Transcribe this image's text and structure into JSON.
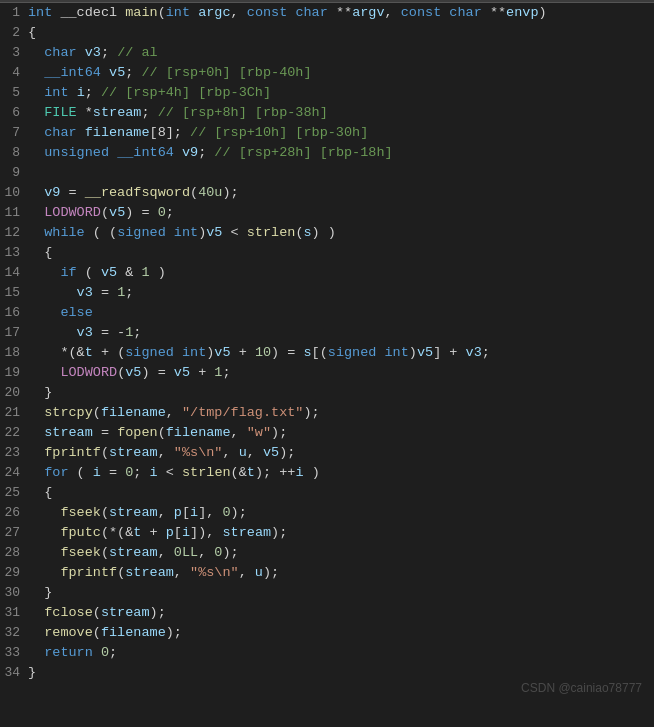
{
  "watermark": "CSDN @cainiao78777",
  "lines": [
    {
      "num": 1,
      "html": "<span class='kw'>int</span> <span class='plain'>__cdecl </span><span class='fn'>main</span><span class='plain'>(</span><span class='kw'>int</span> <span class='var'>argc</span><span class='plain'>, </span><span class='kw'>const</span> <span class='kw'>char</span> <span class='plain'>**</span><span class='var'>argv</span><span class='plain'>, </span><span class='kw'>const</span> <span class='kw'>char</span> <span class='plain'>**</span><span class='var'>envp</span><span class='plain'>)</span>"
    },
    {
      "num": 2,
      "html": "<span class='plain'>{</span>"
    },
    {
      "num": 3,
      "html": "<span class='plain'>  </span><span class='kw'>char</span> <span class='var'>v3</span><span class='plain'>; </span><span class='cmt'>// al</span>"
    },
    {
      "num": 4,
      "html": "<span class='plain'>  </span><span class='kw'>__int64</span> <span class='var'>v5</span><span class='plain'>; </span><span class='cmt'>// [rsp+0h] [rbp-40h]</span>"
    },
    {
      "num": 5,
      "html": "<span class='plain'>  </span><span class='kw'>int</span> <span class='var'>i</span><span class='plain'>; </span><span class='cmt'>// [rsp+4h] [rbp-3Ch]</span>"
    },
    {
      "num": 6,
      "html": "<span class='plain'>  </span><span class='type'>FILE</span> <span class='plain'>*</span><span class='var'>stream</span><span class='plain'>; </span><span class='cmt'>// [rsp+8h] [rbp-38h]</span>"
    },
    {
      "num": 7,
      "html": "<span class='plain'>  </span><span class='kw'>char</span> <span class='var'>filename</span><span class='plain'>[8]; </span><span class='cmt'>// [rsp+10h] [rbp-30h]</span>"
    },
    {
      "num": 8,
      "html": "<span class='plain'>  </span><span class='kw'>unsigned</span> <span class='kw'>__int64</span> <span class='var'>v9</span><span class='plain'>; </span><span class='cmt'>// [rsp+28h] [rbp-18h]</span>"
    },
    {
      "num": 9,
      "html": ""
    },
    {
      "num": 10,
      "html": "<span class='plain'>  </span><span class='var'>v9</span><span class='plain'> = </span><span class='fn'>__readfsqword</span><span class='plain'>(</span><span class='num'>40u</span><span class='plain'>);</span>"
    },
    {
      "num": 11,
      "html": "<span class='plain'>  </span><span class='macro'>LODWORD</span><span class='plain'>(</span><span class='var'>v5</span><span class='plain'>) = </span><span class='num'>0</span><span class='plain'>;</span>"
    },
    {
      "num": 12,
      "html": "<span class='plain'>  </span><span class='kw'>while</span><span class='plain'> ( (</span><span class='kw'>signed int</span><span class='plain'>)</span><span class='var'>v5</span><span class='plain'> &lt; </span><span class='fn'>strlen</span><span class='plain'>(</span><span class='var'>s</span><span class='plain'>) )</span>"
    },
    {
      "num": 13,
      "html": "<span class='plain'>  {</span>"
    },
    {
      "num": 14,
      "html": "<span class='plain'>    </span><span class='kw'>if</span><span class='plain'> ( </span><span class='var'>v5</span><span class='plain'> &amp; </span><span class='num'>1</span><span class='plain'> )</span>"
    },
    {
      "num": 15,
      "html": "<span class='plain'>      </span><span class='var'>v3</span><span class='plain'> = </span><span class='num'>1</span><span class='plain'>;</span>"
    },
    {
      "num": 16,
      "html": "<span class='plain'>    </span><span class='kw'>else</span>"
    },
    {
      "num": 17,
      "html": "<span class='plain'>      </span><span class='var'>v3</span><span class='plain'> = -</span><span class='num'>1</span><span class='plain'>;</span>"
    },
    {
      "num": 18,
      "html": "<span class='plain'>    *(</span><span class='plain'>&amp;</span><span class='var'>t</span><span class='plain'> + (</span><span class='kw'>signed int</span><span class='plain'>)</span><span class='var'>v5</span><span class='plain'> + </span><span class='num'>10</span><span class='plain'>) = </span><span class='var'>s</span><span class='plain'>[(</span><span class='kw'>signed int</span><span class='plain'>)</span><span class='var'>v5</span><span class='plain'>] + </span><span class='var'>v3</span><span class='plain'>;</span>"
    },
    {
      "num": 19,
      "html": "<span class='plain'>    </span><span class='macro'>LODWORD</span><span class='plain'>(</span><span class='var'>v5</span><span class='plain'>) = </span><span class='var'>v5</span><span class='plain'> + </span><span class='num'>1</span><span class='plain'>;</span>"
    },
    {
      "num": 20,
      "html": "<span class='plain'>  }</span>"
    },
    {
      "num": 21,
      "html": "<span class='plain'>  </span><span class='fn'>strcpy</span><span class='plain'>(</span><span class='var'>filename</span><span class='plain'>, </span><span class='str'>\"/tmp/flag.txt\"</span><span class='plain'>);</span>"
    },
    {
      "num": 22,
      "html": "<span class='plain'>  </span><span class='var'>stream</span><span class='plain'> = </span><span class='fn'>fopen</span><span class='plain'>(</span><span class='var'>filename</span><span class='plain'>, </span><span class='str'>\"w\"</span><span class='plain'>);</span>"
    },
    {
      "num": 23,
      "html": "<span class='plain'>  </span><span class='fn'>fprintf</span><span class='plain'>(</span><span class='var'>stream</span><span class='plain'>, </span><span class='str'>\"%s\\n\"</span><span class='plain'>, </span><span class='var'>u</span><span class='plain'>, </span><span class='var'>v5</span><span class='plain'>);</span>"
    },
    {
      "num": 24,
      "html": "<span class='plain'>  </span><span class='kw'>for</span><span class='plain'> ( </span><span class='var'>i</span><span class='plain'> = </span><span class='num'>0</span><span class='plain'>; </span><span class='var'>i</span><span class='plain'> &lt; </span><span class='fn'>strlen</span><span class='plain'>(&amp;</span><span class='var'>t</span><span class='plain'>); ++</span><span class='var'>i</span><span class='plain'> )</span>"
    },
    {
      "num": 25,
      "html": "<span class='plain'>  {</span>"
    },
    {
      "num": 26,
      "html": "<span class='plain'>    </span><span class='fn'>fseek</span><span class='plain'>(</span><span class='var'>stream</span><span class='plain'>, </span><span class='var'>p</span><span class='plain'>[</span><span class='var'>i</span><span class='plain'>], </span><span class='num'>0</span><span class='plain'>);</span>"
    },
    {
      "num": 27,
      "html": "<span class='plain'>    </span><span class='fn'>fputc</span><span class='plain'>(*(&amp;</span><span class='var'>t</span><span class='plain'> + </span><span class='var'>p</span><span class='plain'>[</span><span class='var'>i</span><span class='plain'>]), </span><span class='var'>stream</span><span class='plain'>);</span>"
    },
    {
      "num": 28,
      "html": "<span class='plain'>    </span><span class='fn'>fseek</span><span class='plain'>(</span><span class='var'>stream</span><span class='plain'>, </span><span class='num'>0LL</span><span class='plain'>, </span><span class='num'>0</span><span class='plain'>);</span>"
    },
    {
      "num": 29,
      "html": "<span class='plain'>    </span><span class='fn'>fprintf</span><span class='plain'>(</span><span class='var'>stream</span><span class='plain'>, </span><span class='str'>\"%s\\n\"</span><span class='plain'>, </span><span class='var'>u</span><span class='plain'>);</span>"
    },
    {
      "num": 30,
      "html": "<span class='plain'>  }</span>"
    },
    {
      "num": 31,
      "html": "<span class='plain'>  </span><span class='fn'>fclose</span><span class='plain'>(</span><span class='var'>stream</span><span class='plain'>);</span>"
    },
    {
      "num": 32,
      "html": "<span class='plain'>  </span><span class='fn'>remove</span><span class='plain'>(</span><span class='var'>filename</span><span class='plain'>);</span>"
    },
    {
      "num": 33,
      "html": "<span class='plain'>  </span><span class='kw'>return</span> <span class='num'>0</span><span class='plain'>;</span>"
    },
    {
      "num": 34,
      "html": "<span class='plain'>}</span>"
    }
  ]
}
